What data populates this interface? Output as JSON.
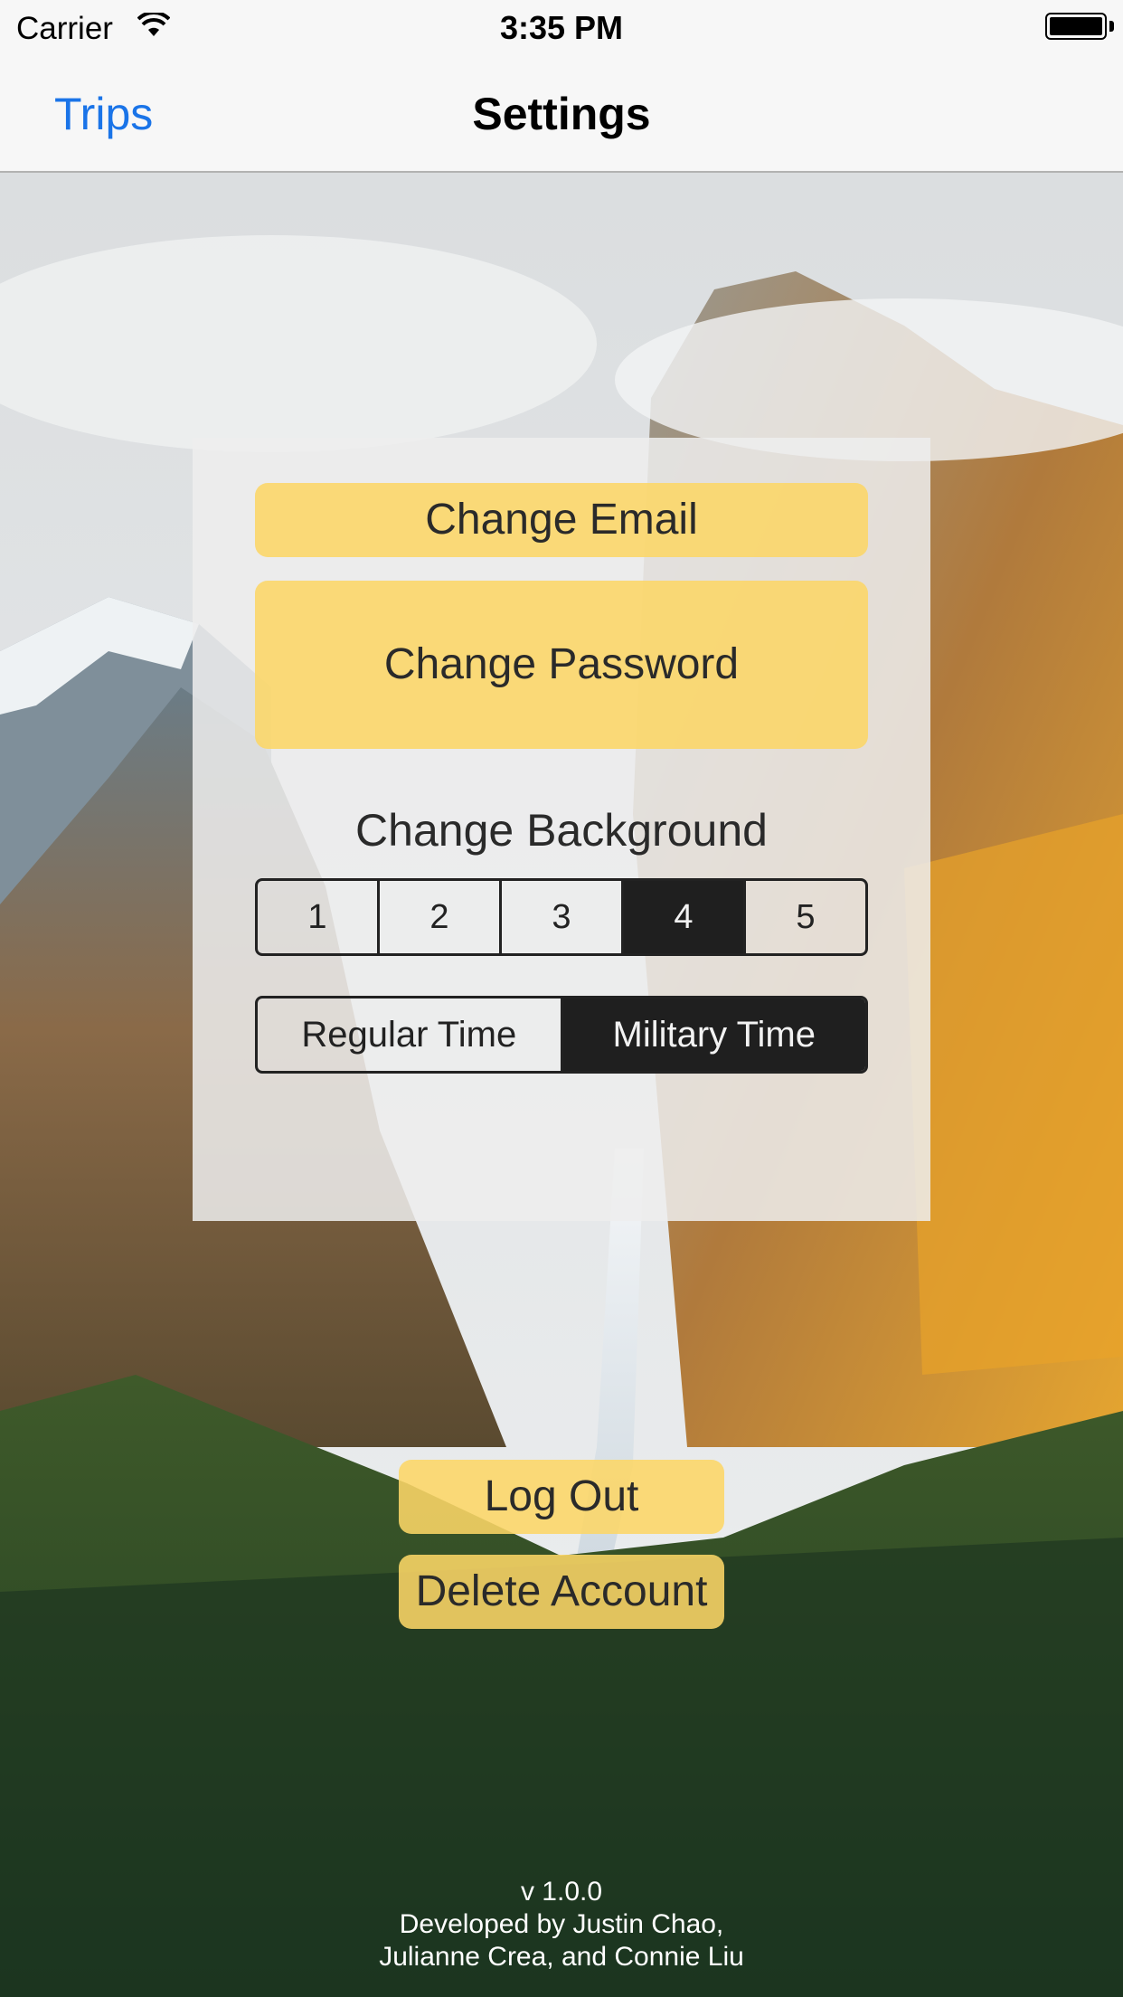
{
  "status_bar": {
    "carrier": "Carrier",
    "time": "3:35 PM",
    "wifi_icon": "wifi-icon",
    "battery_icon": "battery-icon"
  },
  "nav": {
    "back_label": "Trips",
    "title": "Settings",
    "accent_color": "#1a74e8"
  },
  "settings": {
    "change_email_label": "Change Email",
    "change_password_label": "Change Password",
    "background_section_label": "Change Background",
    "background_options": [
      "1",
      "2",
      "3",
      "4",
      "5"
    ],
    "background_selected": "4",
    "time_options": [
      "Regular Time",
      "Military Time"
    ],
    "time_selected": "Military Time"
  },
  "account": {
    "log_out_label": "Log Out",
    "delete_account_label": "Delete Account"
  },
  "footer": {
    "version": "v 1.0.0",
    "credits_line1": "Developed by Justin Chao,",
    "credits_line2": "Julianne Crea, and Connie Liu"
  },
  "colors": {
    "button_yellow": "#fcd666",
    "segment_selected": "#1f1f1f"
  }
}
